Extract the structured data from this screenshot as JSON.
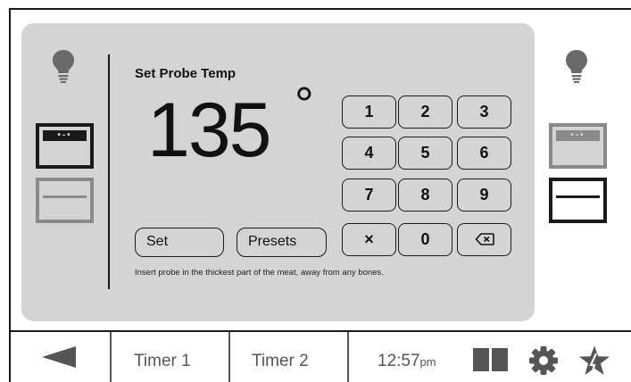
{
  "oven": {
    "left": {
      "upper_status": "selected",
      "lower_status": "inactive"
    },
    "right": {
      "upper_status": "inactive",
      "lower_status": "selected"
    }
  },
  "probe": {
    "title": "Set Probe Temp",
    "temperature": "135",
    "degree_symbol": "°",
    "set_label": "Set",
    "presets_label": "Presets",
    "hint": "Insert probe in the thickest part of the meat, away from any bones."
  },
  "keypad": {
    "keys": [
      "1",
      "2",
      "3",
      "4",
      "5",
      "6",
      "7",
      "8",
      "9",
      "×",
      "0"
    ],
    "backspace_icon": "backspace-icon"
  },
  "bottom_bar": {
    "back_icon": "back-arrow-icon",
    "timer1": "Timer 1",
    "timer2": "Timer 2",
    "time": "12:57",
    "ampm": "pm",
    "icons": [
      "split-view-icon",
      "gear-icon",
      "favorite-star-icon"
    ]
  },
  "colors": {
    "panel": "#d4d4d4",
    "active": "#1a1a1a",
    "inactive": "#8a8a8a",
    "bar_text": "#555555"
  }
}
